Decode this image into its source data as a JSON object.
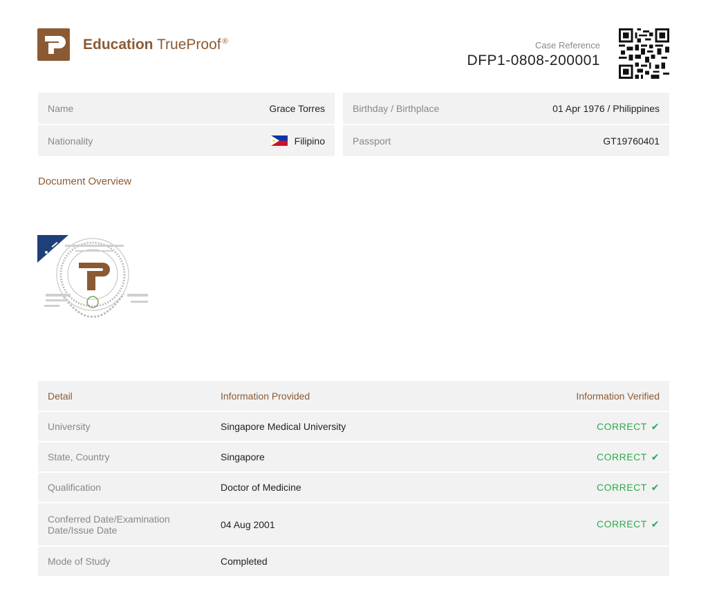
{
  "brand": {
    "name_bold": "Education",
    "name_regular": "TrueProof",
    "registered": "®"
  },
  "case": {
    "label": "Case Reference",
    "value": "DFP1-0808-200001"
  },
  "info": {
    "name_label": "Name",
    "name_value": "Grace Torres",
    "birth_label": "Birthday / Birthplace",
    "birth_value": "01 Apr 1976 / Philippines",
    "nationality_label": "Nationality",
    "nationality_value": "Filipino",
    "passport_label": "Passport",
    "passport_value": "GT19760401"
  },
  "overview_title": "Document Overview",
  "table": {
    "headers": [
      "Detail",
      "Information Provided",
      "Information Verified"
    ],
    "rows": [
      {
        "detail": "University",
        "provided": "Singapore Medical University",
        "verified": "CORRECT"
      },
      {
        "detail": "State, Country",
        "provided": "Singapore",
        "verified": "CORRECT"
      },
      {
        "detail": "Qualification",
        "provided": "Doctor of Medicine",
        "verified": "CORRECT"
      },
      {
        "detail": "Conferred Date/Examination Date/Issue Date",
        "provided": "04 Aug 2001",
        "verified": "CORRECT"
      },
      {
        "detail": "Mode of Study",
        "provided": "Completed",
        "verified": ""
      }
    ]
  },
  "colors": {
    "brand": "#8b5a33",
    "correct": "#2fa84f",
    "cell_bg": "#f2f2f2"
  },
  "icons": {
    "logo": "trueproof-logo-icon",
    "check": "checkmark-icon",
    "flag": "philippines-flag-icon",
    "qr": "qr-code-icon"
  }
}
